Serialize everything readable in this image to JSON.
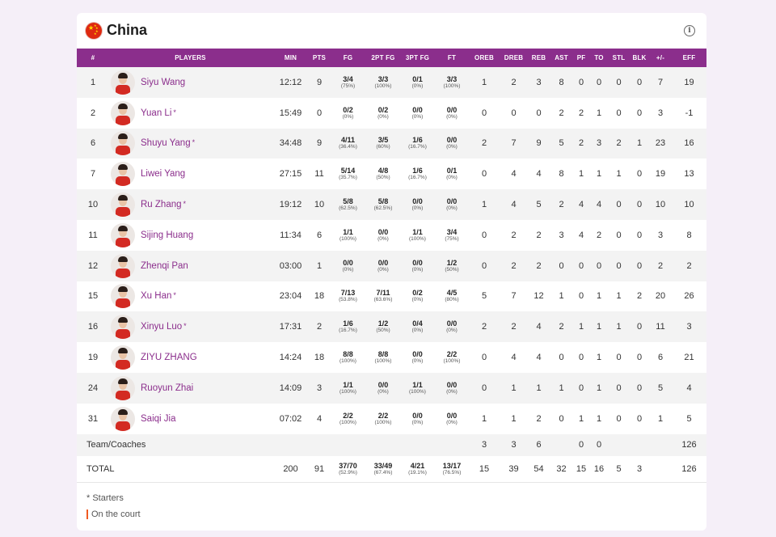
{
  "header": {
    "team": "China",
    "flag_colors": {
      "red": "#de2910",
      "yellow": "#ffde00"
    },
    "info_icon": "info-circle-icon"
  },
  "accent_color": "#8b2e8c",
  "columns": [
    "#",
    "PLAYERS",
    "MIN",
    "PTS",
    "FG",
    "2PT FG",
    "3PT FG",
    "FT",
    "OREB",
    "DREB",
    "REB",
    "AST",
    "PF",
    "TO",
    "STL",
    "BLK",
    "+/-",
    "EFF"
  ],
  "players": [
    {
      "num": "1",
      "name": "Siyu Wang",
      "starter": false,
      "min": "12:12",
      "pts": "9",
      "fg": "3/4",
      "fg_pct": "(75%)",
      "fg2": "3/3",
      "fg2_pct": "(100%)",
      "fg3": "0/1",
      "fg3_pct": "(0%)",
      "ft": "3/3",
      "ft_pct": "(100%)",
      "oreb": "1",
      "dreb": "2",
      "reb": "3",
      "ast": "8",
      "pf": "0",
      "to": "0",
      "stl": "0",
      "blk": "0",
      "pm": "7",
      "eff": "19"
    },
    {
      "num": "2",
      "name": "Yuan Li",
      "starter": true,
      "min": "15:49",
      "pts": "0",
      "fg": "0/2",
      "fg_pct": "(0%)",
      "fg2": "0/2",
      "fg2_pct": "(0%)",
      "fg3": "0/0",
      "fg3_pct": "(0%)",
      "ft": "0/0",
      "ft_pct": "(0%)",
      "oreb": "0",
      "dreb": "0",
      "reb": "0",
      "ast": "2",
      "pf": "2",
      "to": "1",
      "stl": "0",
      "blk": "0",
      "pm": "3",
      "eff": "-1"
    },
    {
      "num": "6",
      "name": "Shuyu Yang",
      "starter": true,
      "min": "34:48",
      "pts": "9",
      "fg": "4/11",
      "fg_pct": "(36.4%)",
      "fg2": "3/5",
      "fg2_pct": "(60%)",
      "fg3": "1/6",
      "fg3_pct": "(16.7%)",
      "ft": "0/0",
      "ft_pct": "(0%)",
      "oreb": "2",
      "dreb": "7",
      "reb": "9",
      "ast": "5",
      "pf": "2",
      "to": "3",
      "stl": "2",
      "blk": "1",
      "pm": "23",
      "eff": "16"
    },
    {
      "num": "7",
      "name": "Liwei Yang",
      "starter": false,
      "min": "27:15",
      "pts": "11",
      "fg": "5/14",
      "fg_pct": "(35.7%)",
      "fg2": "4/8",
      "fg2_pct": "(50%)",
      "fg3": "1/6",
      "fg3_pct": "(16.7%)",
      "ft": "0/1",
      "ft_pct": "(0%)",
      "oreb": "0",
      "dreb": "4",
      "reb": "4",
      "ast": "8",
      "pf": "1",
      "to": "1",
      "stl": "1",
      "blk": "0",
      "pm": "19",
      "eff": "13"
    },
    {
      "num": "10",
      "name": "Ru Zhang",
      "starter": true,
      "min": "19:12",
      "pts": "10",
      "fg": "5/8",
      "fg_pct": "(62.5%)",
      "fg2": "5/8",
      "fg2_pct": "(62.5%)",
      "fg3": "0/0",
      "fg3_pct": "(0%)",
      "ft": "0/0",
      "ft_pct": "(0%)",
      "oreb": "1",
      "dreb": "4",
      "reb": "5",
      "ast": "2",
      "pf": "4",
      "to": "4",
      "stl": "0",
      "blk": "0",
      "pm": "10",
      "eff": "10"
    },
    {
      "num": "11",
      "name": "Sijing Huang",
      "starter": false,
      "min": "11:34",
      "pts": "6",
      "fg": "1/1",
      "fg_pct": "(100%)",
      "fg2": "0/0",
      "fg2_pct": "(0%)",
      "fg3": "1/1",
      "fg3_pct": "(100%)",
      "ft": "3/4",
      "ft_pct": "(75%)",
      "oreb": "0",
      "dreb": "2",
      "reb": "2",
      "ast": "3",
      "pf": "4",
      "to": "2",
      "stl": "0",
      "blk": "0",
      "pm": "3",
      "eff": "8"
    },
    {
      "num": "12",
      "name": "Zhenqi Pan",
      "starter": false,
      "min": "03:00",
      "pts": "1",
      "fg": "0/0",
      "fg_pct": "(0%)",
      "fg2": "0/0",
      "fg2_pct": "(0%)",
      "fg3": "0/0",
      "fg3_pct": "(0%)",
      "ft": "1/2",
      "ft_pct": "(50%)",
      "oreb": "0",
      "dreb": "2",
      "reb": "2",
      "ast": "0",
      "pf": "0",
      "to": "0",
      "stl": "0",
      "blk": "0",
      "pm": "2",
      "eff": "2"
    },
    {
      "num": "15",
      "name": "Xu Han",
      "starter": true,
      "min": "23:04",
      "pts": "18",
      "fg": "7/13",
      "fg_pct": "(53.8%)",
      "fg2": "7/11",
      "fg2_pct": "(63.6%)",
      "fg3": "0/2",
      "fg3_pct": "(0%)",
      "ft": "4/5",
      "ft_pct": "(80%)",
      "oreb": "5",
      "dreb": "7",
      "reb": "12",
      "ast": "1",
      "pf": "0",
      "to": "1",
      "stl": "1",
      "blk": "2",
      "pm": "20",
      "eff": "26"
    },
    {
      "num": "16",
      "name": "Xinyu Luo",
      "starter": true,
      "min": "17:31",
      "pts": "2",
      "fg": "1/6",
      "fg_pct": "(16.7%)",
      "fg2": "1/2",
      "fg2_pct": "(50%)",
      "fg3": "0/4",
      "fg3_pct": "(0%)",
      "ft": "0/0",
      "ft_pct": "(0%)",
      "oreb": "2",
      "dreb": "2",
      "reb": "4",
      "ast": "2",
      "pf": "1",
      "to": "1",
      "stl": "1",
      "blk": "0",
      "pm": "11",
      "eff": "3"
    },
    {
      "num": "19",
      "name": "ZIYU ZHANG",
      "starter": false,
      "min": "14:24",
      "pts": "18",
      "fg": "8/8",
      "fg_pct": "(100%)",
      "fg2": "8/8",
      "fg2_pct": "(100%)",
      "fg3": "0/0",
      "fg3_pct": "(0%)",
      "ft": "2/2",
      "ft_pct": "(100%)",
      "oreb": "0",
      "dreb": "4",
      "reb": "4",
      "ast": "0",
      "pf": "0",
      "to": "1",
      "stl": "0",
      "blk": "0",
      "pm": "6",
      "eff": "21"
    },
    {
      "num": "24",
      "name": "Ruoyun Zhai",
      "starter": false,
      "min": "14:09",
      "pts": "3",
      "fg": "1/1",
      "fg_pct": "(100%)",
      "fg2": "0/0",
      "fg2_pct": "(0%)",
      "fg3": "1/1",
      "fg3_pct": "(100%)",
      "ft": "0/0",
      "ft_pct": "(0%)",
      "oreb": "0",
      "dreb": "1",
      "reb": "1",
      "ast": "1",
      "pf": "0",
      "to": "1",
      "stl": "0",
      "blk": "0",
      "pm": "5",
      "eff": "4"
    },
    {
      "num": "31",
      "name": "Saiqi Jia",
      "starter": false,
      "min": "07:02",
      "pts": "4",
      "fg": "2/2",
      "fg_pct": "(100%)",
      "fg2": "2/2",
      "fg2_pct": "(100%)",
      "fg3": "0/0",
      "fg3_pct": "(0%)",
      "ft": "0/0",
      "ft_pct": "(0%)",
      "oreb": "1",
      "dreb": "1",
      "reb": "2",
      "ast": "0",
      "pf": "1",
      "to": "1",
      "stl": "0",
      "blk": "0",
      "pm": "1",
      "eff": "5"
    }
  ],
  "team_row": {
    "label": "Team/Coaches",
    "oreb": "3",
    "dreb": "3",
    "reb": "6",
    "pf": "0",
    "to": "0",
    "eff": "126"
  },
  "total_row": {
    "label": "TOTAL",
    "min": "200",
    "pts": "91",
    "fg": "37/70",
    "fg_pct": "(52.9%)",
    "fg2": "33/49",
    "fg2_pct": "(67.4%)",
    "fg3": "4/21",
    "fg3_pct": "(19.1%)",
    "ft": "13/17",
    "ft_pct": "(76.5%)",
    "oreb": "15",
    "dreb": "39",
    "reb": "54",
    "ast": "32",
    "pf": "15",
    "to": "16",
    "stl": "5",
    "blk": "3",
    "eff": "126"
  },
  "footer": {
    "starter_marker": "*",
    "starters_note": "* Starters",
    "court_note": "On the court",
    "court_color": "#f05a22"
  }
}
